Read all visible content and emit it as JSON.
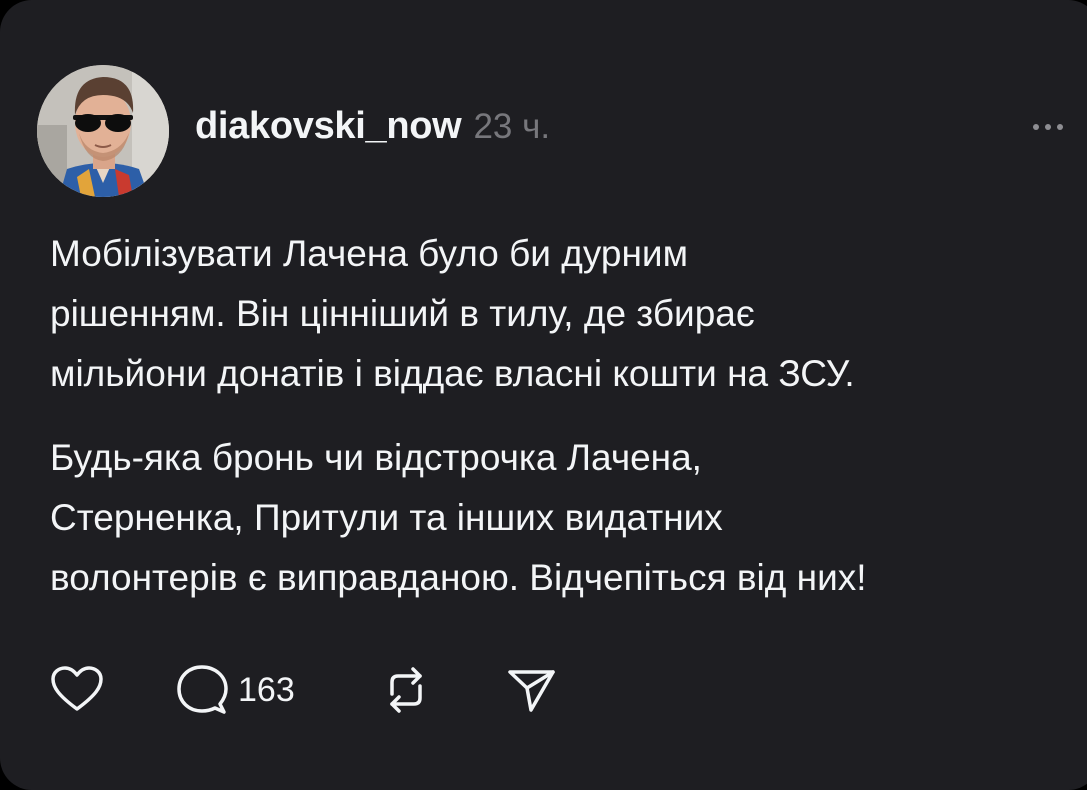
{
  "post": {
    "username": "diakovski_now",
    "time": "23 ч.",
    "paragraphs": [
      "Мобілізувати Лачена було би дурним\nрішенням. Він цінніший в тилу, де збирає\nмільйони донатів і віддає власні кошти на ЗСУ.",
      "Будь-яка бронь чи відстрочка Лачена,\nСтерненка, Притули та інших видатних\nволонтерів є виправданою. Відчепіться від них!"
    ]
  },
  "actions": {
    "like_icon": "heart-icon",
    "reply_icon": "comment-bubble-icon",
    "reply_count": "163",
    "repost_icon": "repost-icon",
    "share_icon": "send-icon",
    "more_icon": "more-horizontal-icon"
  },
  "colors": {
    "background": "#000000",
    "card": "#1e1e22",
    "text": "#f3f5f7",
    "muted": "#77777c"
  }
}
